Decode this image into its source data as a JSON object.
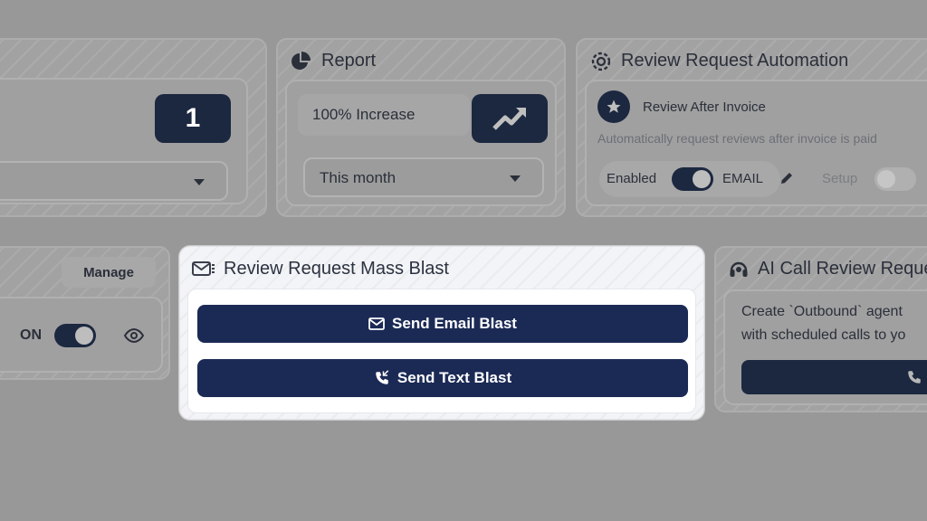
{
  "left_card": {
    "count": "1"
  },
  "report_card": {
    "title": "Report",
    "increase_text": "100% Increase",
    "period_select": "This month"
  },
  "automation_card": {
    "title": "Review Request Automation",
    "item_title": "Review After Invoice",
    "item_desc": "Automatically request reviews after invoice is paid",
    "enabled_label": "Enabled",
    "channel_label": "EMAIL",
    "setup_label": "Setup",
    "cut_label": "S"
  },
  "left_lower_card": {
    "manage_label": "Manage",
    "on_label": "ON"
  },
  "mass_blast_card": {
    "title": "Review Request Mass Blast",
    "email_button": "Send Email Blast",
    "text_button": "Send Text Blast"
  },
  "ai_call_card": {
    "title": "AI Call Review Reque",
    "desc_line1": "Create `Outbound` agent",
    "desc_line2": "with scheduled calls to yo"
  }
}
